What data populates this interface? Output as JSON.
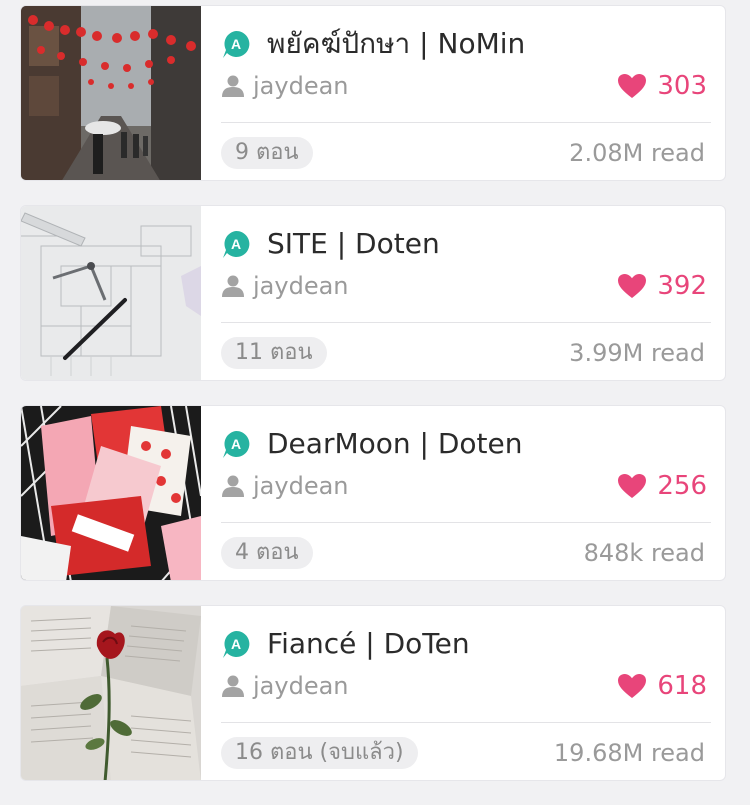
{
  "colors": {
    "badge": "#26b3a1",
    "heart": "#e8457a",
    "muted_text": "#9a9a9a",
    "title_text": "#2b2b2b",
    "background": "#f1f1f3"
  },
  "icons": {
    "badge": "badge-a-icon",
    "author": "user-icon",
    "likes": "heart-icon"
  },
  "stories": [
    {
      "title": "พยัคฆ์ปักษา | NoMin",
      "author": "jaydean",
      "likes": "303",
      "chapters": "9 ตอน",
      "reads": "2.08M read",
      "badge_letter": "A"
    },
    {
      "title": "SITE | Doten",
      "author": "jaydean",
      "likes": "392",
      "chapters": "11 ตอน",
      "reads": "3.99M read",
      "badge_letter": "A"
    },
    {
      "title": "DearMoon | Doten",
      "author": "jaydean",
      "likes": "256",
      "chapters": "4 ตอน",
      "reads": "848k read",
      "badge_letter": "A"
    },
    {
      "title": "Fiancé | DoTen",
      "author": "jaydean",
      "likes": "618",
      "chapters": "16 ตอน (จบแล้ว)",
      "reads": "19.68M read",
      "badge_letter": "A"
    }
  ]
}
